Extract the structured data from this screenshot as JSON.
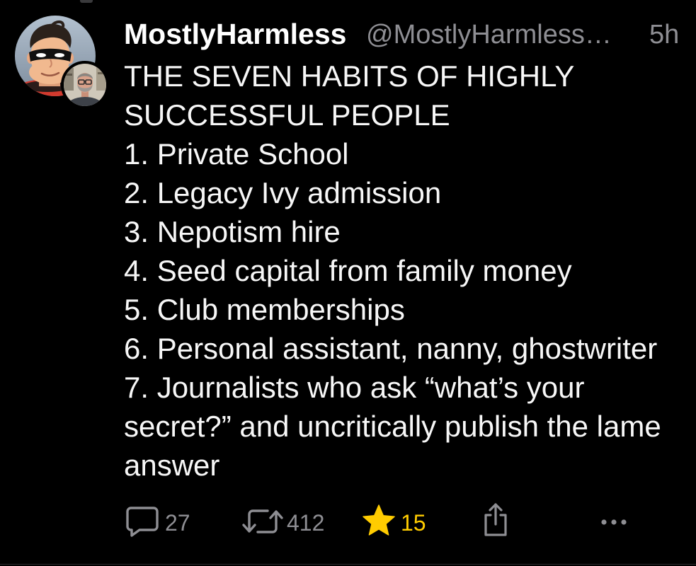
{
  "tweet": {
    "author": {
      "display_name": "MostlyHarmless",
      "handle": "@MostlyHarmless…"
    },
    "timestamp": "5h",
    "body_lines": [
      "THE SEVEN HABITS OF HIGHLY",
      "SUCCESSFUL PEOPLE",
      "1. Private School",
      "2. Legacy Ivy admission",
      "3. Nepotism hire",
      "4. Seed capital from family money",
      "5. Club memberships",
      "6. Personal assistant, nanny, ghostwriter",
      "7. Journalists who ask “what’s your",
      "secret?” and uncritically publish the lame",
      "answer"
    ],
    "actions": {
      "reply": {
        "icon": "reply-icon",
        "count": "27"
      },
      "retweet": {
        "icon": "retweet-icon",
        "count": "412"
      },
      "favorite": {
        "icon": "star-icon",
        "count": "15",
        "active": true
      },
      "share": {
        "icon": "share-icon"
      },
      "more": {
        "icon": "more-icon"
      }
    }
  },
  "colors": {
    "background": "#000000",
    "text": "#f5f5f5",
    "muted": "#8e8e93",
    "favorite": "#ffcc00"
  }
}
